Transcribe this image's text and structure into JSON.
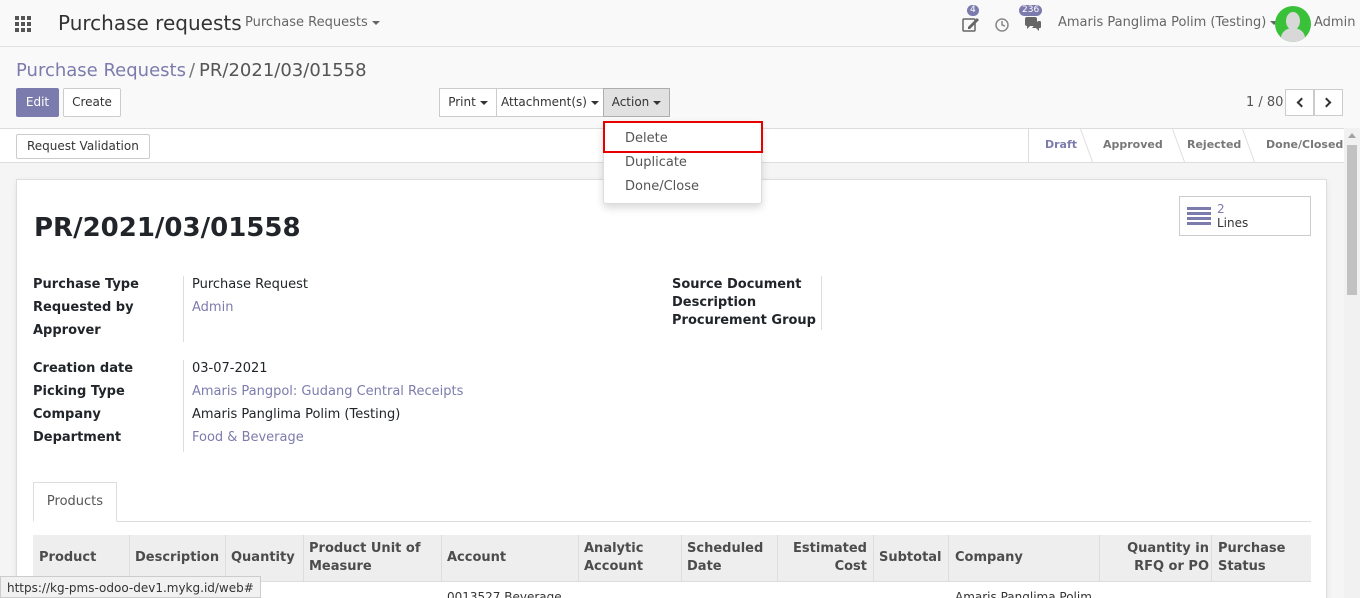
{
  "navbar": {
    "app_title": "Purchase requests",
    "menu": "Purchase Requests",
    "activity_badge": "4",
    "messages_badge": "236",
    "company": "Amaris Panglima Polim (Testing)",
    "user": "Admin"
  },
  "control": {
    "breadcrumb_parent": "Purchase Requests",
    "breadcrumb_sep": "/",
    "breadcrumb_current": "PR/2021/03/01558",
    "edit_label": "Edit",
    "create_label": "Create",
    "print_label": "Print",
    "attachments_label": "Attachment(s)",
    "action_label": "Action",
    "pager": "1 / 80"
  },
  "action_menu": {
    "items": [
      "Delete",
      "Duplicate",
      "Done/Close"
    ]
  },
  "statusbar": {
    "validate_label": "Request Validation",
    "stages": [
      "Draft",
      "Approved",
      "Rejected",
      "Done/Closed"
    ],
    "active_stage": "Draft"
  },
  "form": {
    "title": "PR/2021/03/01558",
    "smart_button": {
      "value": "2",
      "label": "Lines"
    },
    "left_group_1": [
      {
        "label": "Purchase Type",
        "value": "Purchase Request",
        "link": false
      },
      {
        "label": "Requested by",
        "value": "Admin",
        "link": true
      },
      {
        "label": "Approver",
        "value": "",
        "link": false
      }
    ],
    "right_group": [
      {
        "label": "Source Document",
        "value": ""
      },
      {
        "label": "Description",
        "value": ""
      },
      {
        "label": "Procurement Group",
        "value": ""
      }
    ],
    "left_group_2": [
      {
        "label": "Creation date",
        "value": "03-07-2021",
        "link": false
      },
      {
        "label": "Picking Type",
        "value": "Amaris Pangpol: Gudang Central Receipts",
        "link": true
      },
      {
        "label": "Company",
        "value": "Amaris Panglima Polim (Testing)",
        "link": false
      },
      {
        "label": "Department",
        "value": "Food & Beverage",
        "link": true
      }
    ],
    "tab_label": "Products"
  },
  "table": {
    "headers": [
      "Product",
      "Description",
      "Quantity",
      "Product Unit of Measure",
      "Account",
      "Analytic Account",
      "Scheduled Date",
      "Estimated Cost",
      "Subtotal",
      "Company",
      "Quantity in RFQ or PO",
      "Purchase Status"
    ],
    "partial_row": {
      "account": "0013527 Beverage",
      "company": "Amaris Panglima Polim"
    }
  },
  "status_url": "https://kg-pms-odoo-dev1.mykg.id/web#",
  "colors": {
    "brand": "#7c7bad",
    "highlight": "#e60000",
    "avatar": "#3ac13a"
  }
}
